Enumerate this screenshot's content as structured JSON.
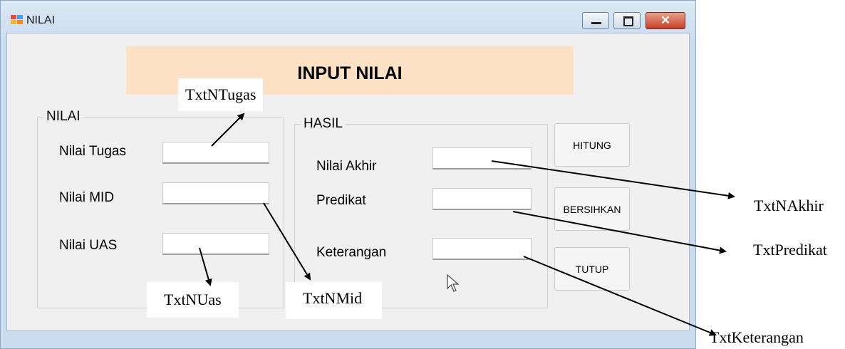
{
  "window": {
    "title": "NILAI",
    "icon": "winforms-app-icon"
  },
  "controls": {
    "minimize": "minimize-icon",
    "maximize": "maximize-icon",
    "close": "close-icon",
    "close_glyph": "✕"
  },
  "banner": {
    "title": "INPUT NILAI"
  },
  "nilai_group": {
    "label": "NILAI",
    "fields": [
      {
        "label": "Nilai Tugas",
        "value": ""
      },
      {
        "label": "Nilai MID",
        "value": ""
      },
      {
        "label": "Nilai UAS",
        "value": ""
      }
    ]
  },
  "hasil_group": {
    "label": "HASIL",
    "fields": [
      {
        "label": "Nilai Akhir",
        "value": ""
      },
      {
        "label": "Predikat",
        "value": ""
      },
      {
        "label": "Keterangan",
        "value": ""
      }
    ]
  },
  "buttons": {
    "hitung": "HITUNG",
    "bersihkan": "BERSIHKAN",
    "tutup": "TUTUP"
  },
  "annotations": {
    "txt_ntugas": "TxtNTugas",
    "txt_nmid": "TxtNMid",
    "txt_nuas": "TxtNUas",
    "txt_nakhir": "TxtNAkhir",
    "txt_predikat": "TxtPredikat",
    "txt_keterangan": "TxtKeterangan"
  }
}
